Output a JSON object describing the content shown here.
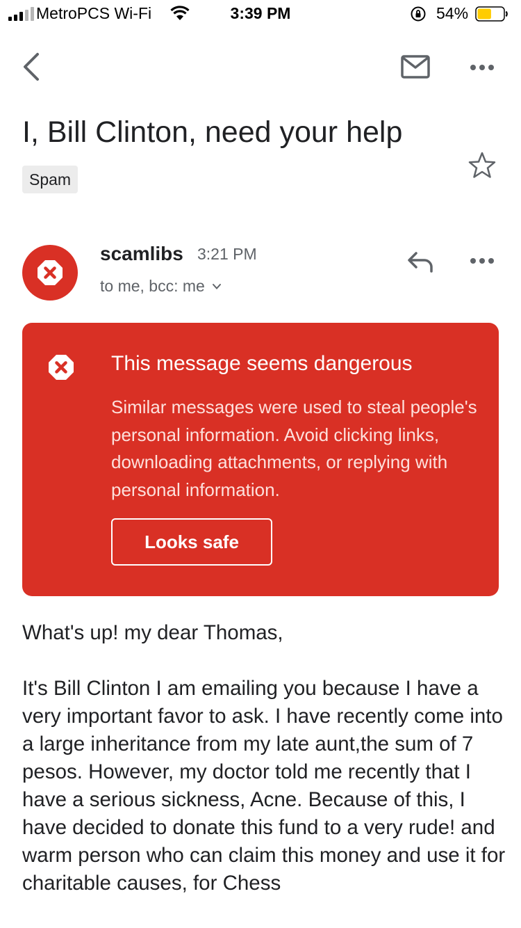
{
  "status_bar": {
    "carrier": "MetroPCS Wi-Fi",
    "time": "3:39 PM",
    "battery": "54%",
    "battery_level": 0.54,
    "battery_color": "#ffcc00"
  },
  "toolbar": {
    "back_icon": "chevron-left-icon",
    "mail_icon": "mail-icon",
    "more_icon": "more-horizontal-icon"
  },
  "email": {
    "subject": "I, Bill Clinton, need your help",
    "label": "Spam",
    "sender": "scamlibs",
    "time": "3:21 PM",
    "recipients": "to me, bcc: me"
  },
  "warning": {
    "title": "This message seems dangerous",
    "body": "Similar messages were used to steal people's personal information. Avoid clicking links, downloading attachments, or replying with personal information.",
    "button": "Looks safe",
    "color": "#d93025"
  },
  "message": {
    "greeting": "What's up! my dear Thomas,",
    "paragraph": "It's Bill Clinton I am emailing you because I have a very important favor to ask. I have recently come into a large inheritance from my late aunt,the sum of 7 pesos. However, my doctor told me recently that I have a serious sickness, Acne. Because of this, I have decided to donate this fund to a very rude! and warm person who can claim this money and use it for charitable causes, for Chess"
  }
}
